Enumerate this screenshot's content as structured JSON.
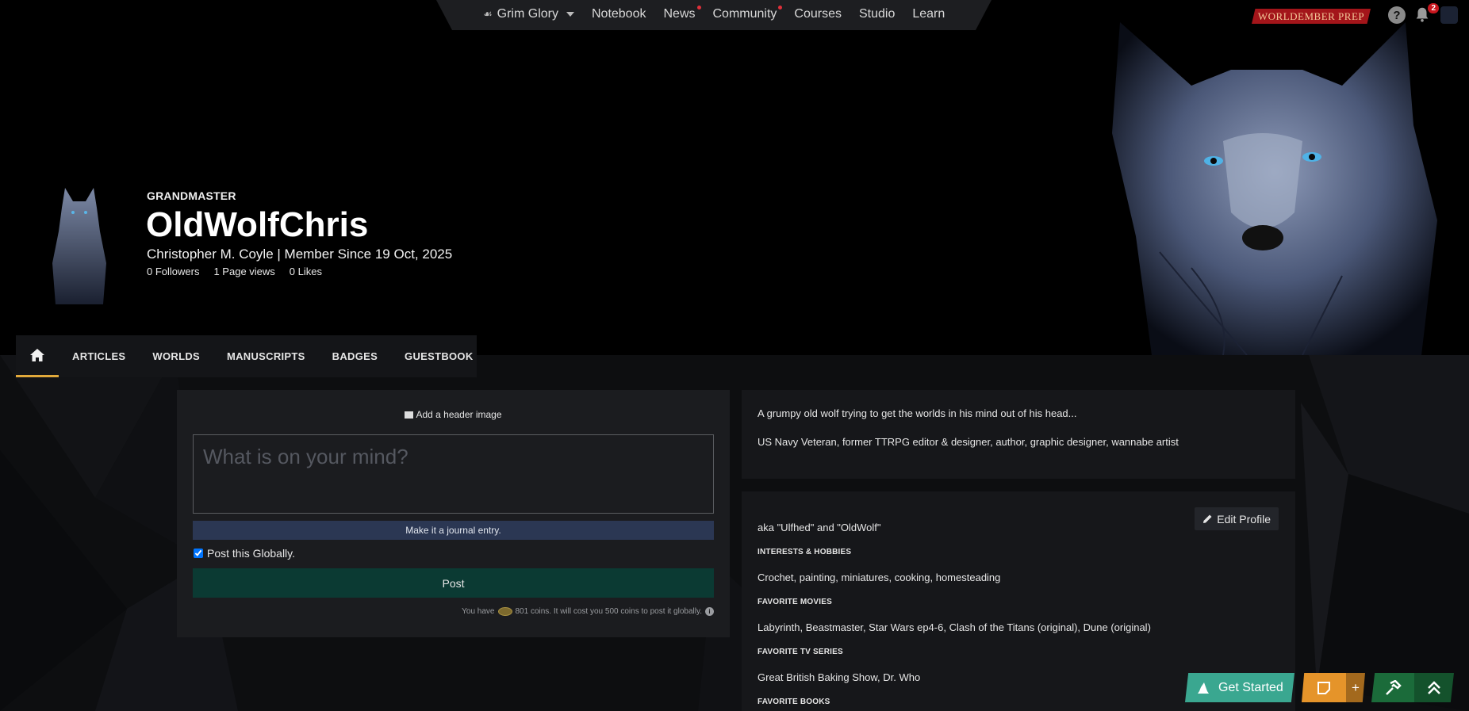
{
  "topnav": {
    "world_name": "Grim Glory",
    "items": [
      {
        "label": "Notebook",
        "dot": false
      },
      {
        "label": "News",
        "dot": true
      },
      {
        "label": "Community",
        "dot": true
      },
      {
        "label": "Courses",
        "dot": false
      },
      {
        "label": "Studio",
        "dot": false
      },
      {
        "label": "Learn",
        "dot": false
      }
    ],
    "dot_color": "#e0303a"
  },
  "prep_badge": "WORLDEMBER PREP",
  "header_icons": {
    "help": "?",
    "notifications_count": "2"
  },
  "profile": {
    "rank": "GRANDMASTER",
    "username": "OldWolfChris",
    "subline": "Christopher M. Coyle | Member Since 19 Oct, 2025",
    "stats": [
      "0 Followers",
      "1 Page views",
      "0 Likes"
    ]
  },
  "tabs": [
    "ARTICLES",
    "WORLDS",
    "MANUSCRIPTS",
    "BADGES",
    "GUESTBOOK"
  ],
  "accent_color": "#e1a93b",
  "post": {
    "add_header": "Add a header image",
    "placeholder": "What is on your mind?",
    "journal_label": "Make it a journal entry.",
    "global_label": "Post this Globally.",
    "post_label": "Post",
    "coins_text": "You have",
    "coins_rest": "801 coins. It will cost you 500 coins to post it globally."
  },
  "bio": {
    "line1": "A grumpy old wolf trying to get the worlds in his mind out of his head...",
    "line2": "US Navy Veteran, former TTRPG editor & designer, author, graphic designer, wannabe artist"
  },
  "details": {
    "edit_label": "Edit Profile",
    "aka": "aka \"Ulfhed\" and \"OldWolf\"",
    "interests_head": "INTERESTS & HOBBIES",
    "interests": "Crochet, painting, miniatures, cooking, homesteading",
    "movies_head": "FAVORITE MOVIES",
    "movies": "Labyrinth, Beastmaster, Star Wars ep4-6, Clash of the Titans (original), Dune (original)",
    "tv_head": "FAVORITE TV SERIES",
    "tv": "Great British Baking Show, Dr. Who",
    "books_head": "FAVORITE BOOKS"
  },
  "widgets": {
    "get_started": "Get Started",
    "plus": "+"
  }
}
